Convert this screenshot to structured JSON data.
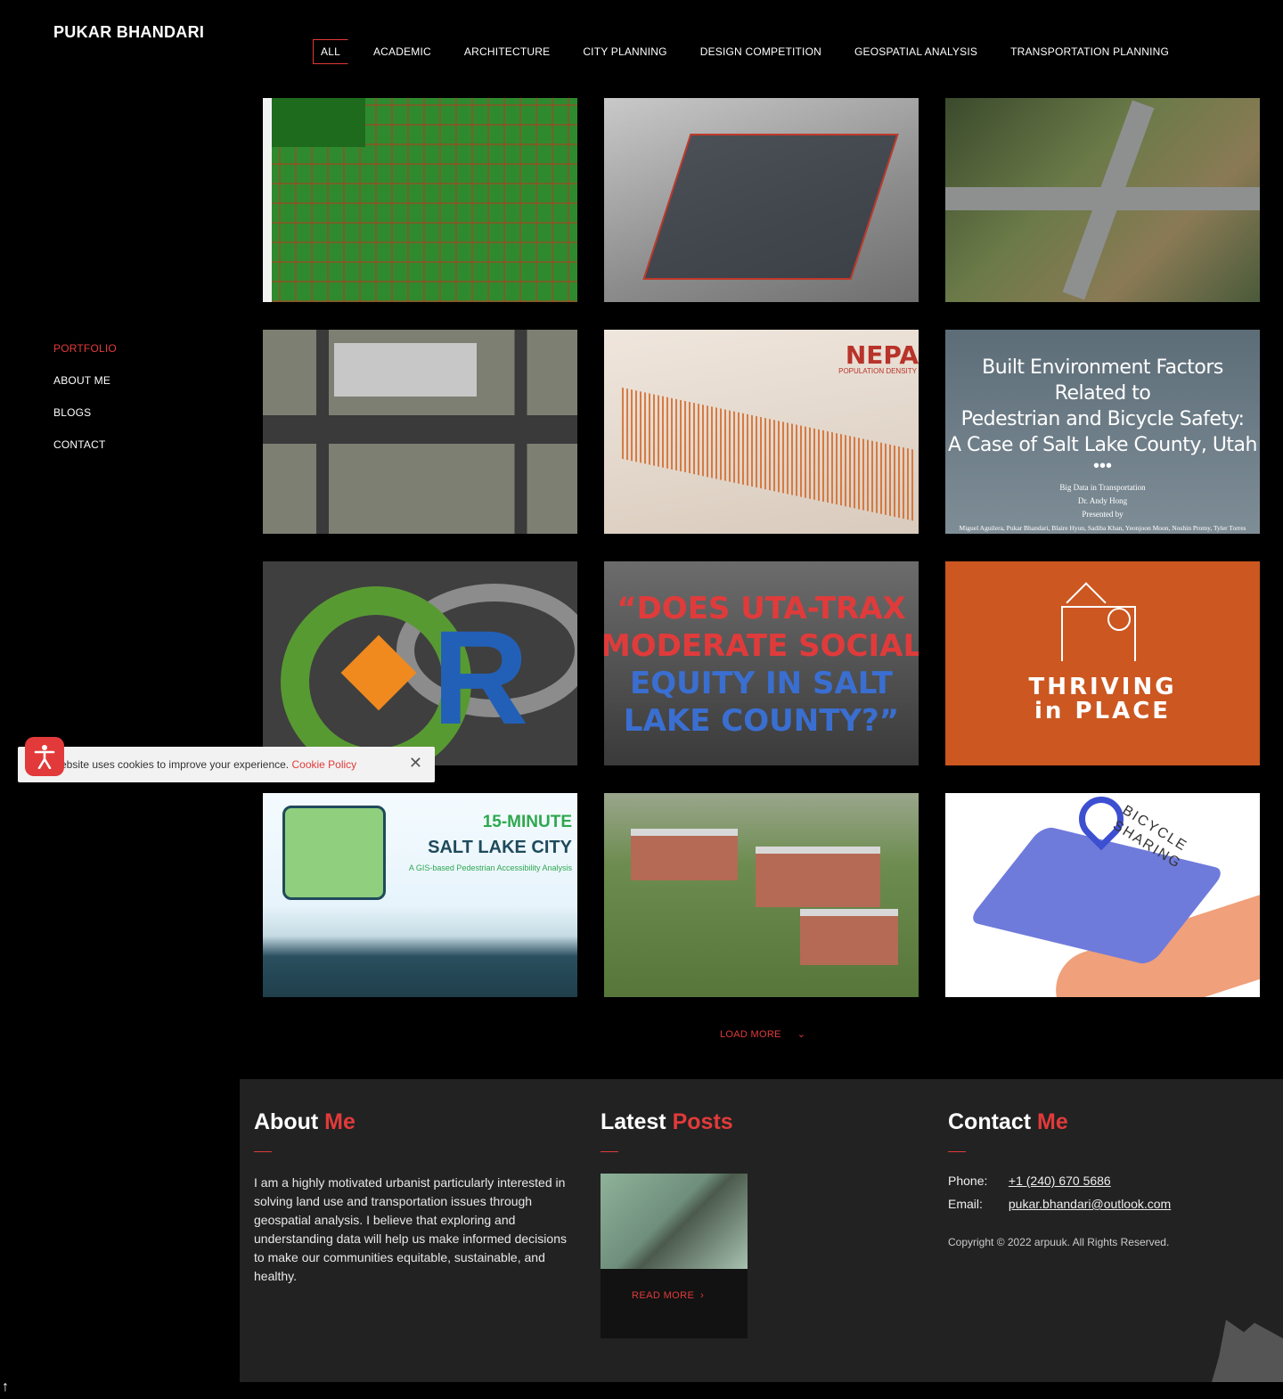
{
  "brand": {
    "name": "PUKAR BHANDARI"
  },
  "filters": [
    {
      "label": "ALL",
      "active": true
    },
    {
      "label": "ACADEMIC"
    },
    {
      "label": "ARCHITECTURE"
    },
    {
      "label": "CITY PLANNING"
    },
    {
      "label": "DESIGN COMPETITION"
    },
    {
      "label": "GEOSPATIAL ANALYSIS"
    },
    {
      "label": "TRANSPORTATION PLANNING"
    }
  ],
  "nav": {
    "portfolio": "PORTFOLIO",
    "about": "ABOUT ME",
    "blogs": "BLOGS",
    "contact": "CONTACT"
  },
  "tiles": {
    "nepa": {
      "title": "NEPA",
      "subtitle": "POPULATION DENSITY"
    },
    "safety": {
      "line1": "Built Environment Factors Related to",
      "line2": "Pedestrian and Bicycle Safety:",
      "line3": "A Case of Salt Lake County, Utah",
      "dots": "•••",
      "course": "Big Data in Transportation",
      "instructor": "Dr. Andy Hong",
      "presented": "Presented by",
      "authors": "Miguel Aguilera, Pukar Bhandari, Blaire Hyun, Sadiba Khan, Yeonjoon Moon, Noshin Promy, Tyler Torres"
    },
    "qr": {
      "letter": "R"
    },
    "trax": {
      "line1": "“DOES UTA-TRAX",
      "line2": "MODERATE SOCIAL",
      "line3": "EQUITY IN SALT",
      "line4": "LAKE COUNTY?”"
    },
    "thriving": {
      "line1": "THRIVING",
      "line2": "in PLACE"
    },
    "fifteen": {
      "line1": "15-MINUTE",
      "line2": "SALT LAKE CITY",
      "line3": "A GIS-based Pedestrian Accessibility Analysis"
    },
    "bike": {
      "line1": "BICYCLE",
      "line2": "SHARING"
    }
  },
  "load_more": "LOAD MORE",
  "cookie": {
    "message": "ebsite uses cookies to improve your experience.",
    "link": "Cookie Policy"
  },
  "footer": {
    "about": {
      "title_a": "About",
      "title_b": "Me",
      "text": "I am a highly motivated urbanist particularly interested in solving land use and transportation issues through geospatial analysis. I believe that exploring and understanding data will help us make informed decisions to make our communities equitable, sustainable, and healthy."
    },
    "posts": {
      "title_a": "Latest",
      "title_b": "Posts",
      "read_more": "READ MORE"
    },
    "contact": {
      "title_a": "Contact",
      "title_b": "Me",
      "phone_label": "Phone:",
      "phone": "+1 (240) 670 5686",
      "email_label": "Email:",
      "email": "pukar.bhandari@outlook.com",
      "copyright": "Copyright © 2022 arpuuk. All Rights Reserved."
    }
  },
  "colors": {
    "accent": "#e23a3a",
    "background": "#000000",
    "footer": "#222222"
  },
  "icons": {
    "accessibility": "accessibility-icon",
    "close": "close-icon",
    "chevron": "chevron-down-icon",
    "to_top": "arrow-up-icon"
  }
}
